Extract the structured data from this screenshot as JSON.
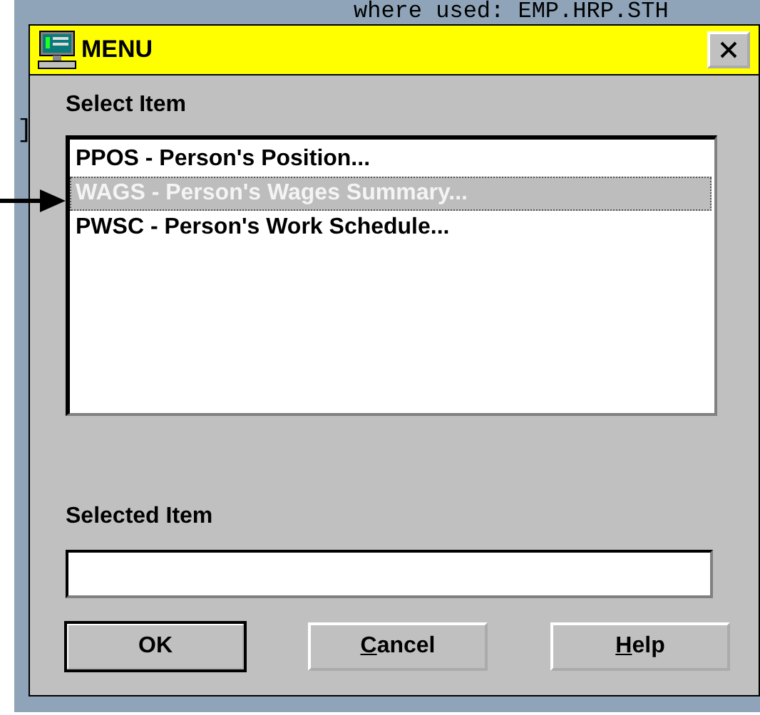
{
  "background": {
    "text": "where used: EMP.HRP.STH",
    "fragment": "]"
  },
  "window": {
    "title": "MENU"
  },
  "list": {
    "label": "Select Item",
    "items": [
      {
        "text": "PPOS - Person's Position...",
        "selected": false
      },
      {
        "text": "WAGS - Person's Wages Summary...",
        "selected": true
      },
      {
        "text": "PWSC - Person's Work Schedule...",
        "selected": false
      }
    ]
  },
  "selected_item": {
    "label": "Selected Item"
  },
  "buttons": [
    {
      "rest": "OK",
      "default": true
    },
    {
      "accel": "C",
      "rest": "ancel",
      "default": false
    },
    {
      "accel": "H",
      "rest": "elp",
      "default": false
    }
  ]
}
